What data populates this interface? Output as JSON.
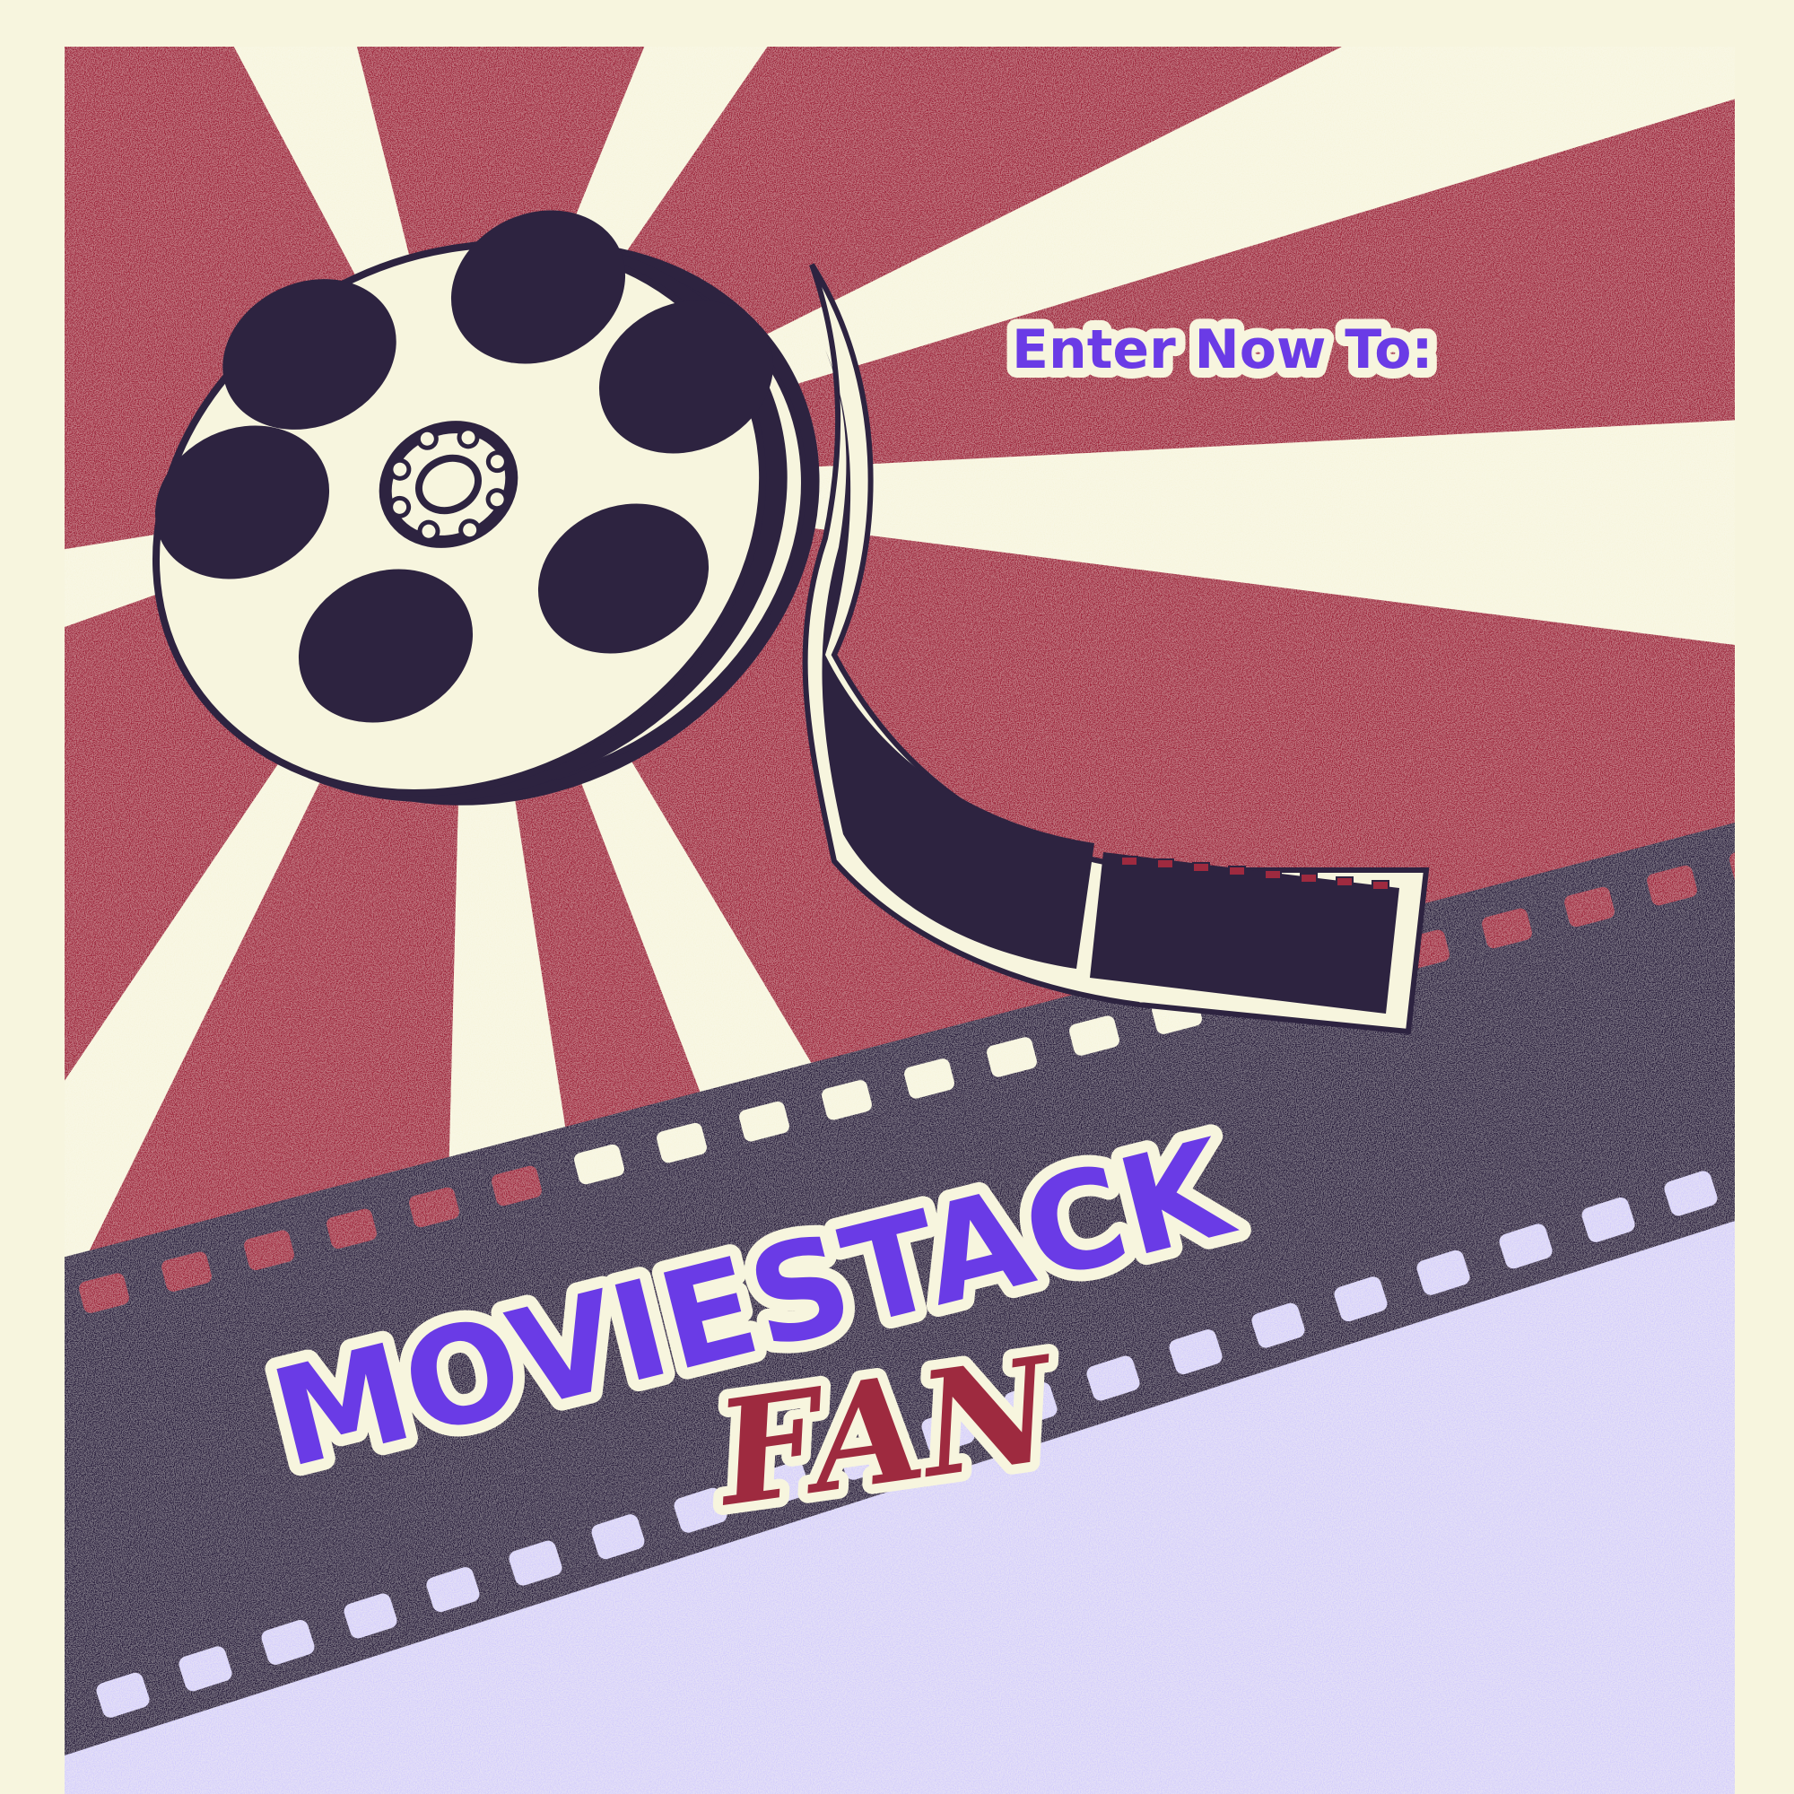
{
  "poster": {
    "tagline": "Enter Now To:",
    "brand": "MOVIESTACK",
    "subtitle": "FAN"
  },
  "colors": {
    "cream": "#f7f5de",
    "crimson": "#9e2a3f",
    "navy": "#2d2340",
    "lavender": "#d6d0fb",
    "purple": "#6a3be6"
  },
  "icons": [
    "film-reel-icon",
    "film-strip-icon"
  ]
}
